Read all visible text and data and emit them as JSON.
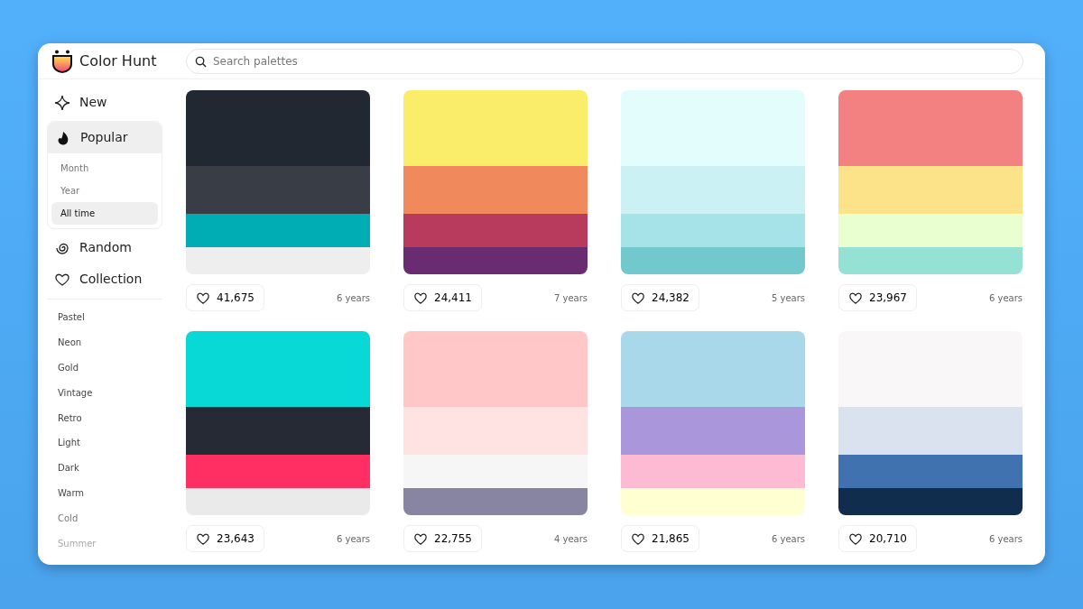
{
  "header": {
    "logo": "Color Hunt",
    "search": {
      "placeholder": "Search palettes"
    }
  },
  "sidebar": {
    "nav": [
      {
        "kind": "new",
        "label": "New",
        "selected": false
      },
      {
        "kind": "popular",
        "label": "Popular",
        "selected": true,
        "expanded": true,
        "children": [
          {
            "label": "Month",
            "selected": false
          },
          {
            "label": "Year",
            "selected": false
          },
          {
            "label": "All time",
            "selected": true
          }
        ]
      },
      {
        "kind": "random",
        "label": "Random",
        "selected": false
      },
      {
        "kind": "collection",
        "label": "Collection",
        "selected": false
      }
    ],
    "tags": [
      "Pastel",
      "Neon",
      "Gold",
      "Vintage",
      "Retro",
      "Light",
      "Dark",
      "Warm",
      "Cold",
      "Summer"
    ]
  },
  "palettes": [
    {
      "swatches": [
        {
          "color": "#222831"
        },
        {
          "color": "#393e46"
        },
        {
          "color": "#00adb5"
        },
        {
          "color": "#eeeeee"
        }
      ],
      "likes": "41,675",
      "age": "6 years"
    },
    {
      "swatches": [
        {
          "color": "#f9ed69"
        },
        {
          "color": "#f08a5d"
        },
        {
          "color": "#b83b5e"
        },
        {
          "color": "#6a2c70"
        }
      ],
      "likes": "24,411",
      "age": "7 years"
    },
    {
      "swatches": [
        {
          "color": "#e3fdfd"
        },
        {
          "color": "#cbf1f5"
        },
        {
          "color": "#a6e3e9"
        },
        {
          "color": "#71c9ce"
        }
      ],
      "likes": "24,382",
      "age": "5 years"
    },
    {
      "swatches": [
        {
          "color": "#f38181"
        },
        {
          "color": "#fce38a"
        },
        {
          "color": "#eaffd0"
        },
        {
          "color": "#95e1d3"
        }
      ],
      "likes": "23,967",
      "age": "6 years"
    },
    {
      "swatches": [
        {
          "color": "#08d9d6"
        },
        {
          "color": "#252a34"
        },
        {
          "color": "#ff2e63"
        },
        {
          "color": "#eaeaea"
        }
      ],
      "likes": "23,643",
      "age": "6 years"
    },
    {
      "swatches": [
        {
          "color": "#ffc7c7"
        },
        {
          "color": "#ffe2e2"
        },
        {
          "color": "#f6f6f6"
        },
        {
          "color": "#8785a2"
        }
      ],
      "likes": "22,755",
      "age": "4 years"
    },
    {
      "swatches": [
        {
          "color": "#a8d8ea"
        },
        {
          "color": "#aa96da"
        },
        {
          "color": "#fcbad3"
        },
        {
          "color": "#ffffd2"
        }
      ],
      "likes": "21,865",
      "age": "6 years"
    },
    {
      "swatches": [
        {
          "color": "#f9f7f7"
        },
        {
          "color": "#dbe2ef"
        },
        {
          "color": "#3f72af"
        },
        {
          "color": "#112d4e"
        }
      ],
      "likes": "20,710",
      "age": "6 years"
    }
  ]
}
